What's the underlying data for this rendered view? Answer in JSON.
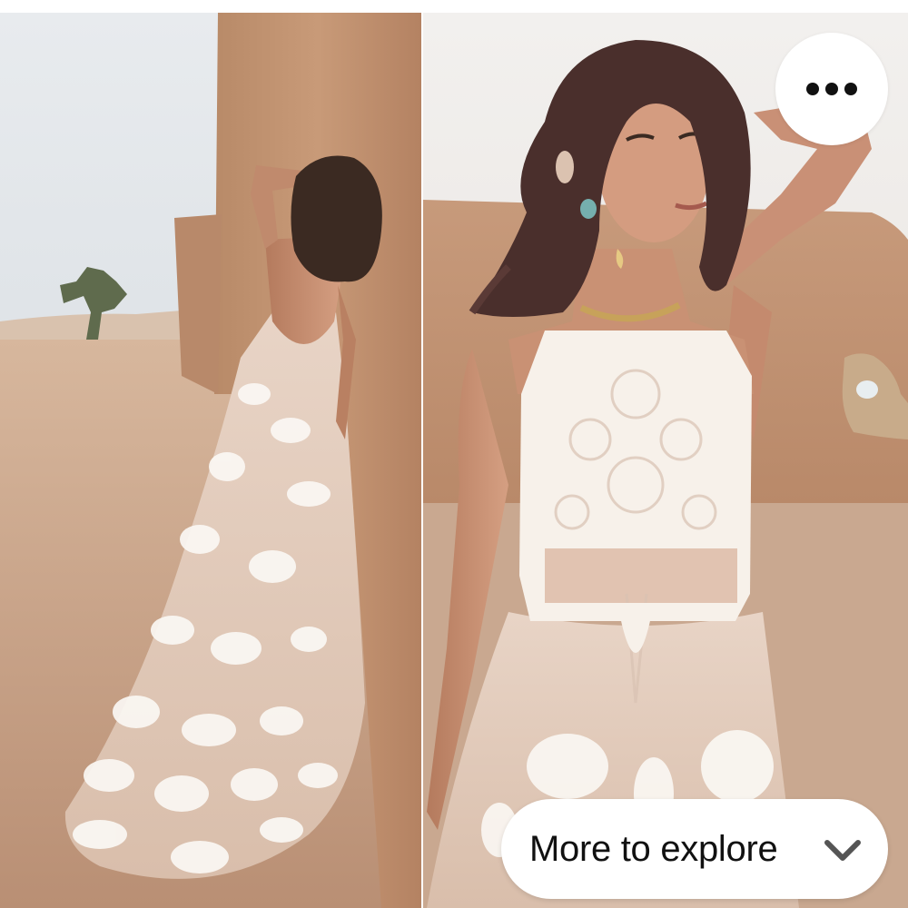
{
  "pin": {
    "image_description_icon": "photo",
    "more_icon": "ellipsis-icon"
  },
  "explore": {
    "label": "More to explore",
    "icon": "chevron-down-icon"
  },
  "colors": {
    "background": "#ffffff",
    "text": "#111111",
    "icon": "#555555"
  }
}
